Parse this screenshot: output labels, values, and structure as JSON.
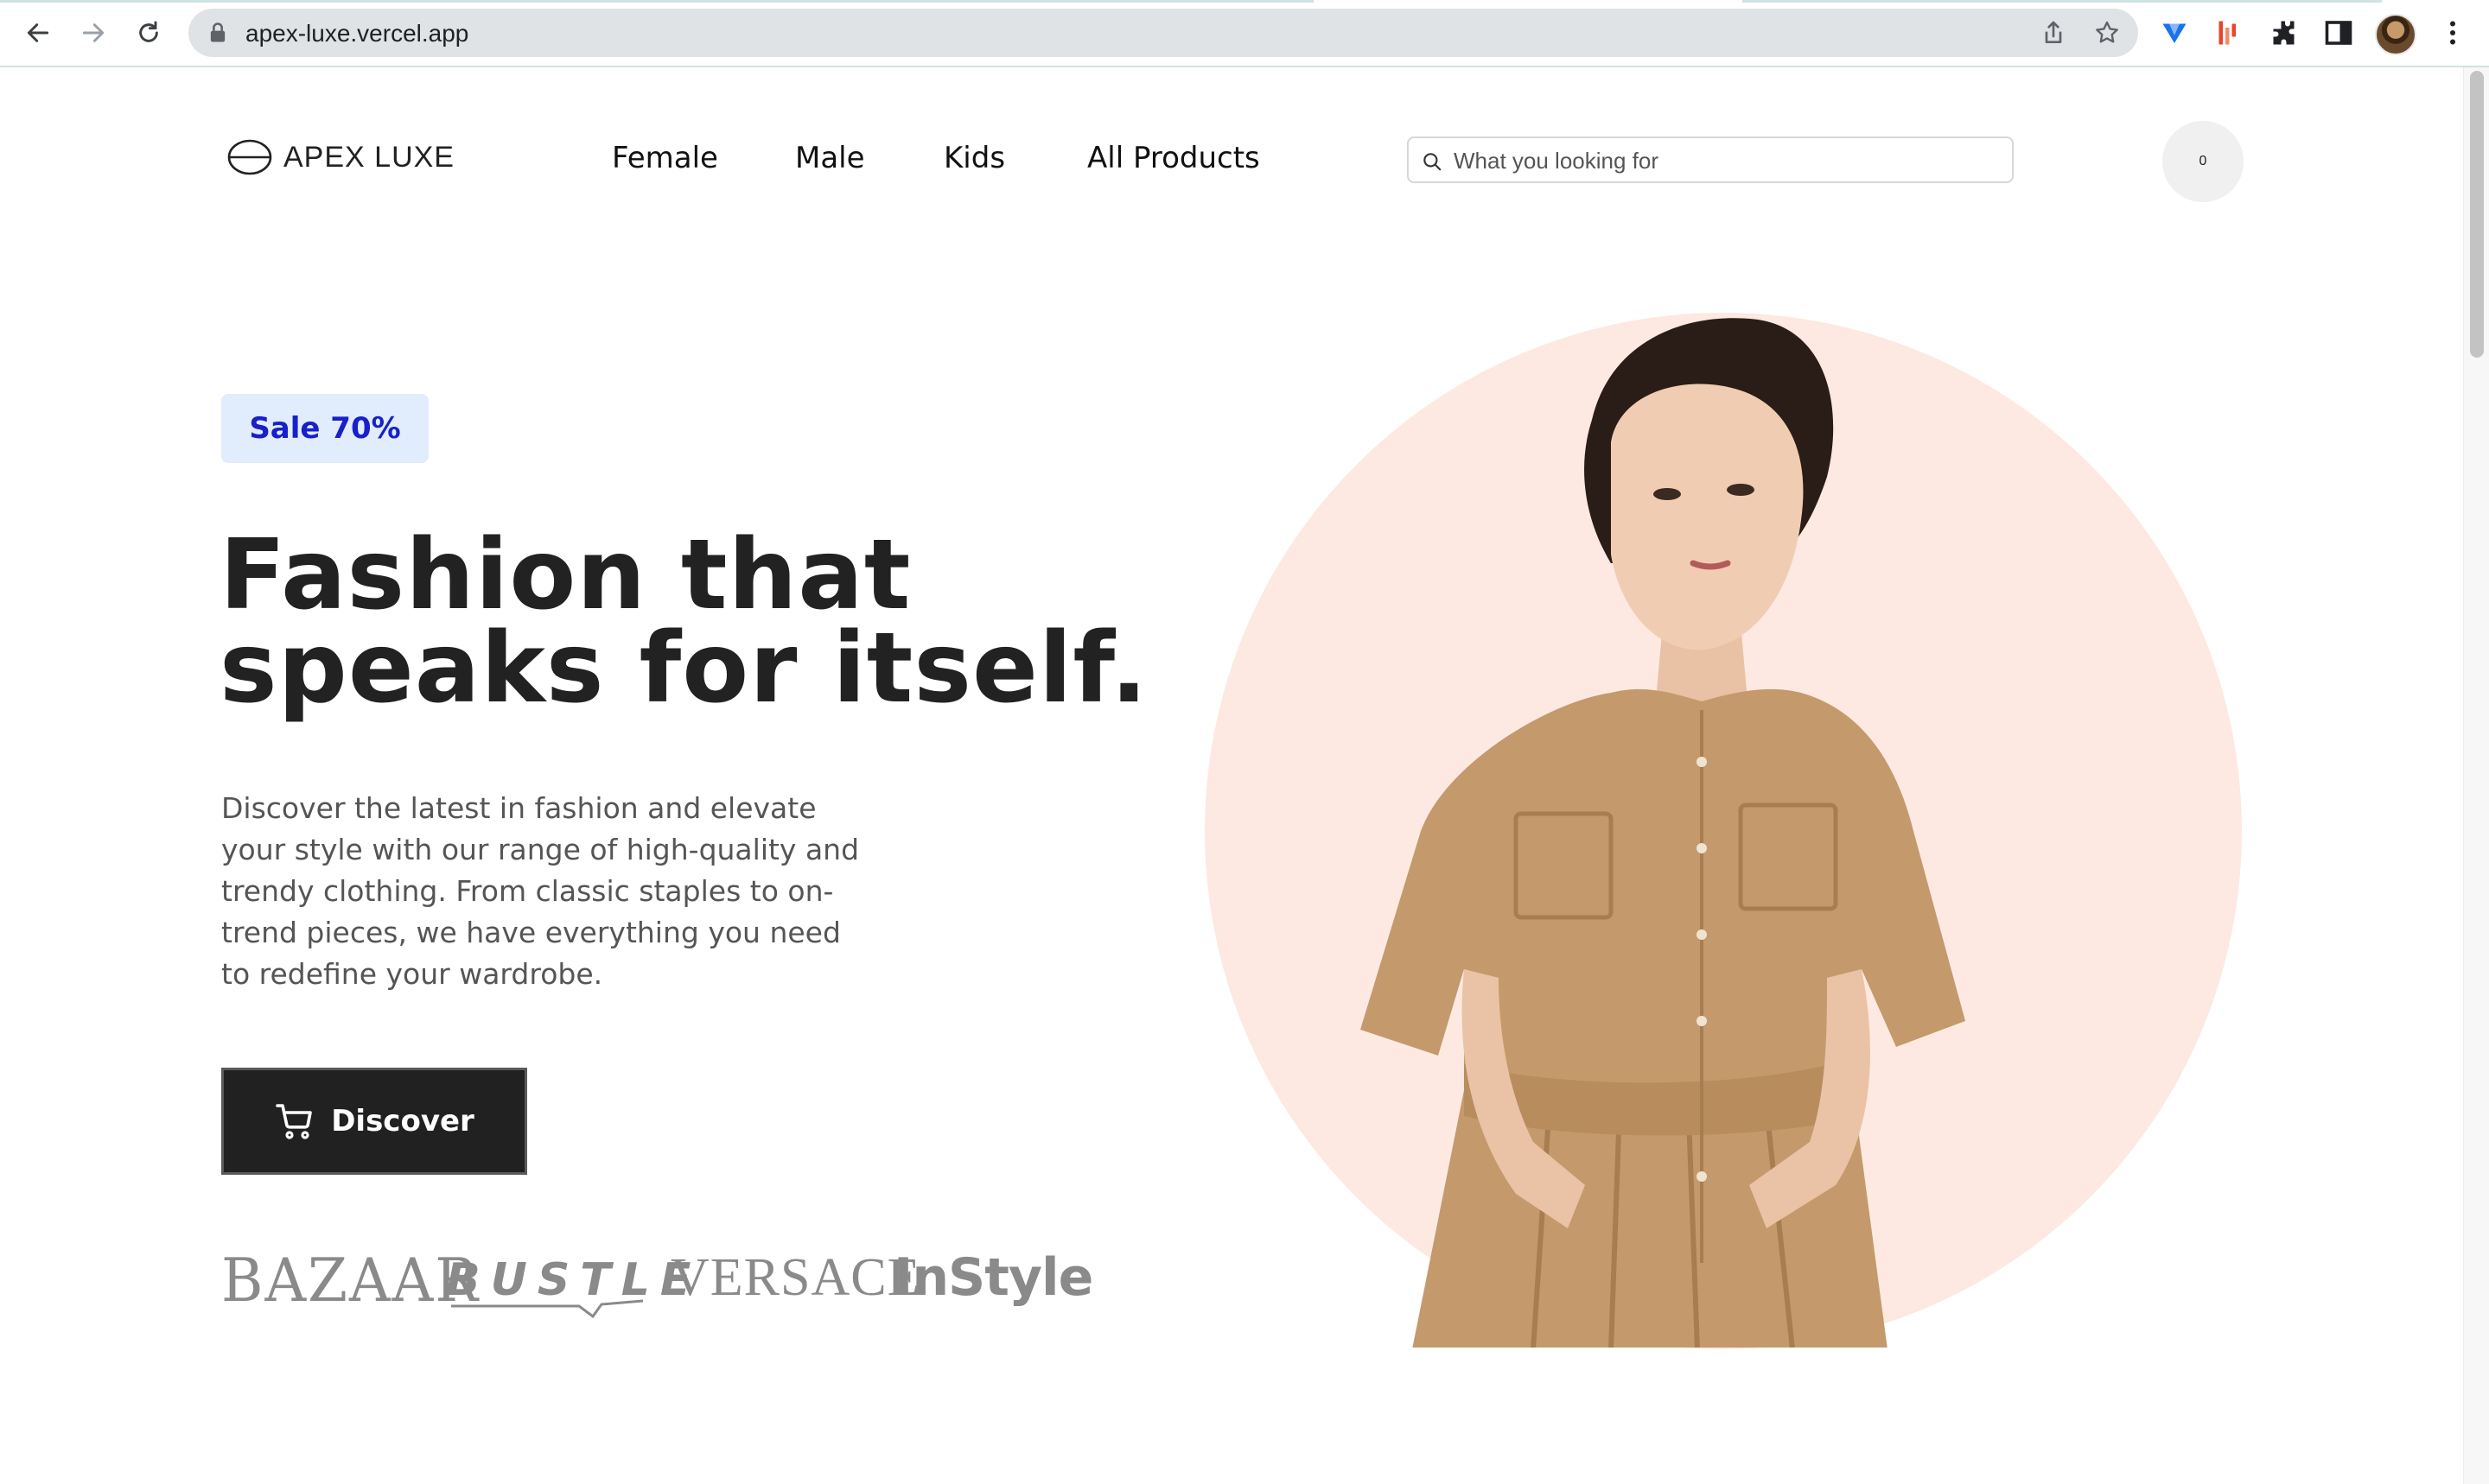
{
  "browser": {
    "url": "apex-luxe.vercel.app",
    "icons": [
      "back-icon",
      "forward-icon",
      "reload-icon",
      "lock-icon",
      "share-icon",
      "bookmark-star-icon",
      "extension-v-icon",
      "extension-bars-icon",
      "puzzle-icon",
      "sidepanel-icon",
      "profile-avatar",
      "kebab-menu-icon"
    ]
  },
  "header": {
    "brand": "APEX LUXE",
    "nav": [
      "Female",
      "Male",
      "Kids",
      "All Products"
    ],
    "search_placeholder": "What you looking for",
    "cart_count": "0"
  },
  "hero": {
    "badge": "Sale 70%",
    "headline_line1": "Fashion that",
    "headline_line2": "speaks for itself.",
    "description": "Discover the latest in fashion and elevate your style with our range of high-quality and trendy clothing. From classic staples to on-trend pieces, we have everything you need to redefine your wardrobe.",
    "cta_label": "Discover",
    "press_logos": [
      "BAZAAR",
      "BUSTLE",
      "VERSACE",
      "InStyle"
    ]
  },
  "colors": {
    "accent_badge_bg": "#e1ecfd",
    "accent_badge_text": "#1820c9",
    "button_bg": "#212121",
    "circle_bg": "#fde9e1",
    "dress": "#c49a6c",
    "cart_badge": "#e8232f"
  }
}
